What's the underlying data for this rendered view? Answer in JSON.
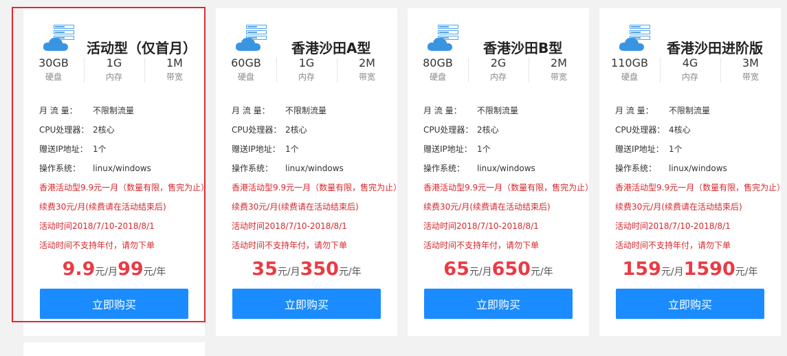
{
  "colors": {
    "accent": "#1a8cff",
    "price": "#ea3b45",
    "promo": "#d8262c",
    "highlight": "#e0282e"
  },
  "plans": [
    {
      "icon": "cloud-server-icon",
      "title": "活动型（仅首月）",
      "specs": [
        {
          "value": "30GB",
          "label": "硬盘"
        },
        {
          "value": "1G",
          "label": "内存"
        },
        {
          "value": "1M",
          "label": "带宽"
        }
      ],
      "traffic": {
        "key": "月 流 量：",
        "value": "不限制流量"
      },
      "cpu": {
        "key": "CPU处理器：",
        "value": "2核心"
      },
      "ip": {
        "key": "赠送IP地址：",
        "value": "1个"
      },
      "os": {
        "key": "操作系统：",
        "value": "linux/windows"
      },
      "promo": [
        "香港活动型9.9元一月（数量有限，售完为止）",
        "续费30元/月(续费请在活动结束后)",
        "活动时间2018/7/10-2018/8/1",
        "活动时间不支持年付，请勿下单"
      ],
      "price_month": "9.9",
      "month_unit": "元/月",
      "price_year": "99",
      "year_unit": "元/年",
      "button": "立即购买"
    },
    {
      "icon": "cloud-server-icon",
      "title": "香港沙田A型",
      "specs": [
        {
          "value": "60GB",
          "label": "硬盘"
        },
        {
          "value": "1G",
          "label": "内存"
        },
        {
          "value": "2M",
          "label": "带宽"
        }
      ],
      "traffic": {
        "key": "月 流 量：",
        "value": "不限制流量"
      },
      "cpu": {
        "key": "CPU处理器：",
        "value": "2核心"
      },
      "ip": {
        "key": "赠送IP地址：",
        "value": "1个"
      },
      "os": {
        "key": "操作系统：",
        "value": "linux/windows"
      },
      "promo": [
        "香港活动型9.9元一月（数量有限，售完为止）",
        "续费30元/月(续费请在活动结束后)",
        "活动时间2018/7/10-2018/8/1",
        "活动时间不支持年付，请勿下单"
      ],
      "price_month": "35",
      "month_unit": "元/月",
      "price_year": "350",
      "year_unit": "元/年",
      "button": "立即购买"
    },
    {
      "icon": "cloud-server-icon",
      "title": "香港沙田B型",
      "specs": [
        {
          "value": "80GB",
          "label": "硬盘"
        },
        {
          "value": "2G",
          "label": "内存"
        },
        {
          "value": "2M",
          "label": "带宽"
        }
      ],
      "traffic": {
        "key": "月 流 量：",
        "value": "不限制流量"
      },
      "cpu": {
        "key": "CPU处理器：",
        "value": "2核心"
      },
      "ip": {
        "key": "赠送IP地址：",
        "value": "1个"
      },
      "os": {
        "key": "操作系统：",
        "value": "linux/windows"
      },
      "promo": [
        "香港活动型9.9元一月（数量有限，售完为止）",
        "续费30元/月(续费请在活动结束后)",
        "活动时间2018/7/10-2018/8/1",
        "活动时间不支持年付，请勿下单"
      ],
      "price_month": "65",
      "month_unit": "元/月",
      "price_year": "650",
      "year_unit": "元/年",
      "button": "立即购买"
    },
    {
      "icon": "cloud-server-icon",
      "title": "香港沙田进阶版",
      "specs": [
        {
          "value": "110GB",
          "label": "硬盘"
        },
        {
          "value": "4G",
          "label": "内存"
        },
        {
          "value": "3M",
          "label": "带宽"
        }
      ],
      "traffic": {
        "key": "月 流 量：",
        "value": "不限制流量"
      },
      "cpu": {
        "key": "CPU处理器：",
        "value": "4核心"
      },
      "ip": {
        "key": "赠送IP地址：",
        "value": "1个"
      },
      "os": {
        "key": "操作系统：",
        "value": "linux/windows"
      },
      "promo": [
        "香港活动型9.9元一月（数量有限，售完为止）",
        "续费30元/月(续费请在活动结束后)",
        "活动时间2018/7/10-2018/8/1",
        "活动时间不支持年付，请勿下单"
      ],
      "price_month": "159",
      "month_unit": "元/月",
      "price_year": "1590",
      "year_unit": "元/年",
      "button": "立即购买"
    }
  ]
}
